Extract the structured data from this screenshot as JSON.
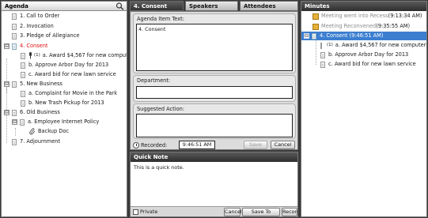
{
  "agenda": {
    "title": "Agenda",
    "icon": "search-icon",
    "items": [
      {
        "label": "1. Call to Order"
      },
      {
        "label": "2. Invocation"
      },
      {
        "label": "3. Pledge of Allegiance"
      },
      {
        "label": "4. Consent",
        "expand": "⊟"
      },
      {
        "label": "a. Award $4,567 for new computers",
        "badge": "(1)"
      },
      {
        "label": "b. Approve Arbor Day for 2013"
      },
      {
        "label": "c. Award bid for new lawn service"
      },
      {
        "label": "5. New Business",
        "expand": "⊟"
      },
      {
        "label": "a. Complaint for Movie in the Park"
      },
      {
        "label": "b. New Trash Pickup for 2013"
      },
      {
        "label": "6. Old Business",
        "expand": "⊟"
      },
      {
        "label": "a. Employee Internet Policy",
        "expand": "⊟"
      },
      {
        "label": "Backup Doc"
      },
      {
        "label": "7. Adjournment"
      }
    ]
  },
  "tabs": [
    {
      "label": "4. Consent",
      "active": true
    },
    {
      "label": "Speakers",
      "active": false
    },
    {
      "label": "Attendees",
      "active": false
    }
  ],
  "form": {
    "agenda_item_text_label": "Agenda Item Text:",
    "agenda_item_text_value": "4. Consent",
    "department_label": "Department:",
    "department_value": "",
    "suggested_action_label": "Suggested Action:",
    "suggested_action_value": "",
    "recorded_label": "Recorded:",
    "recorded_time": "9:46:51 AM",
    "save_label": "Save",
    "cancel_label": "Cancel"
  },
  "quick_note": {
    "title": "Quick Note",
    "text": "This is a quick note.",
    "private_label": "Private",
    "cancel_label": "Cancel",
    "save_to_selected_label": "Save To Selected",
    "record_label": "Record"
  },
  "minutes": {
    "title": "Minutes",
    "entries": [
      {
        "label": "Meeting went into Recess",
        "time": " (9:13:34 AM)"
      },
      {
        "label": "Meeting Reconvened",
        "time": " (9:35:55 AM)"
      },
      {
        "label": "4. Consent (9:46:51 AM)",
        "expand": "⊟"
      },
      {
        "label": "a. Award $4,567 for new computers",
        "badge": "(1)"
      },
      {
        "label": "b. Approve Arbor Day for 2013"
      },
      {
        "label": "c. Award bid for new lawn service"
      }
    ]
  },
  "colors": {
    "header_dark": "#3a3a3a",
    "selection": "#3c7ed0",
    "current_item": "#dd1111",
    "event_icon": "#e6b23a"
  }
}
